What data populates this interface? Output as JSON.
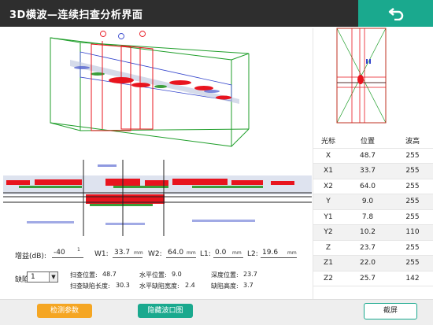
{
  "title": "3D横波—连续扫查分析界面",
  "icons": {
    "back": "back-arrow-icon"
  },
  "controls": {
    "gain_label": "增益(dB):",
    "gain_value": "-40",
    "gain_step": "1",
    "w1_label": "W1:",
    "w1_value": "33.7",
    "w1_unit": "mm",
    "w2_label": "W2:",
    "w2_value": "64.0",
    "w2_unit": "mm",
    "l1_label": "L1:",
    "l1_value": "0.0",
    "l1_unit": "mm",
    "l2_label": "L2:",
    "l2_value": "19.6",
    "l2_unit": "mm",
    "defect_label": "缺陷:",
    "defect_value": "1"
  },
  "measurements": {
    "scan_pos_label": "扫查位置:",
    "scan_pos_value": "48.7",
    "scan_len_label": "扫查缺陷长度:",
    "scan_len_value": "30.3",
    "h_pos_label": "水平位置:",
    "h_pos_value": "9.0",
    "h_width_label": "水平缺陷宽度:",
    "h_width_value": "2.4",
    "depth_label": "深度位置:",
    "depth_value": "23.7",
    "height_label": "缺陷高度:",
    "height_value": "3.7"
  },
  "table": {
    "headers": [
      "光标",
      "位置",
      "波高"
    ],
    "rows": [
      [
        "X",
        "48.7",
        "255"
      ],
      [
        "X1",
        "33.7",
        "255"
      ],
      [
        "X2",
        "64.0",
        "255"
      ],
      [
        "Y",
        "9.0",
        "255"
      ],
      [
        "Y1",
        "7.8",
        "255"
      ],
      [
        "Y2",
        "10.2",
        "110"
      ],
      [
        "Z",
        "23.7",
        "255"
      ],
      [
        "Z1",
        "22.0",
        "255"
      ],
      [
        "Z2",
        "25.7",
        "142"
      ]
    ]
  },
  "buttons": {
    "params": "检测参数",
    "hide_wave": "隐藏波口图",
    "screenshot": "截屏"
  },
  "colors": {
    "accent": "#1aa98e",
    "orange": "#f5a623",
    "titlebar": "#2e2e2e",
    "defect": "#e8141e"
  }
}
